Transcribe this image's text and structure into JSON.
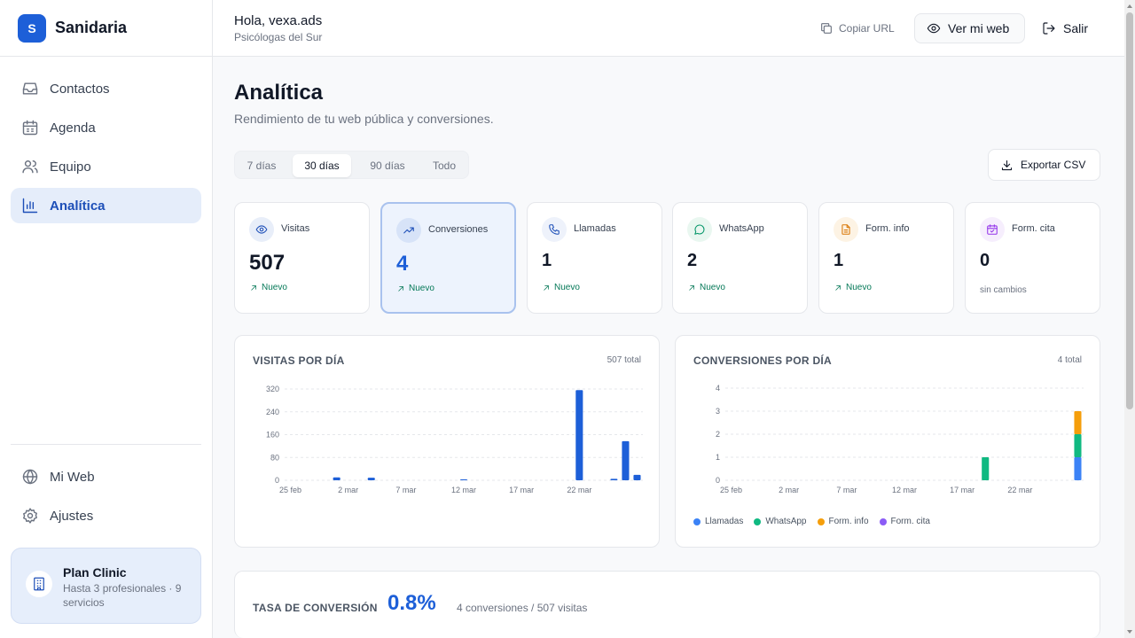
{
  "brand": {
    "initial": "S",
    "name": "Sanidaria",
    "accent": "#1d5fd8"
  },
  "sidebar": {
    "items": [
      {
        "label": "Contactos",
        "icon": "inbox-icon"
      },
      {
        "label": "Agenda",
        "icon": "calendar-icon"
      },
      {
        "label": "Equipo",
        "icon": "users-icon"
      },
      {
        "label": "Analítica",
        "icon": "bar-chart-icon",
        "active": true
      }
    ],
    "bottom_items": [
      {
        "label": "Mi Web",
        "icon": "globe-icon"
      },
      {
        "label": "Ajustes",
        "icon": "gear-icon"
      }
    ],
    "plan": {
      "title": "Plan Clinic",
      "description": "Hasta 3 profesionales · 9 servicios",
      "icon": "building-icon"
    }
  },
  "header": {
    "greeting": "Hola, vexa.ads",
    "organization": "Psicólogas del Sur",
    "copy_url_label": "Copiar URL",
    "view_site_label": "Ver mi web",
    "logout_label": "Salir"
  },
  "page": {
    "title": "Analítica",
    "subtitle": "Rendimiento de tu web pública y conversiones.",
    "range_tabs": [
      "7 días",
      "30 días",
      "90 días",
      "Todo"
    ],
    "selected_range": "30 días",
    "export_label": "Exportar CSV"
  },
  "kpis": [
    {
      "label": "Visitas",
      "value": "507",
      "trend": "Nuevo",
      "icon": "eye-icon",
      "color": "#1d4fb8"
    },
    {
      "label": "Conversiones",
      "value": "4",
      "trend": "Nuevo",
      "icon": "trending-up-icon",
      "color": "#1d4fb8",
      "selected": true
    },
    {
      "label": "Llamadas",
      "value": "1",
      "trend": "Nuevo",
      "icon": "phone-icon",
      "color": "#1d4fb8"
    },
    {
      "label": "WhatsApp",
      "value": "2",
      "trend": "Nuevo",
      "icon": "message-circle-icon",
      "color": "#059669"
    },
    {
      "label": "Form. info",
      "value": "1",
      "trend": "Nuevo",
      "icon": "file-text-icon",
      "color": "#d97706"
    },
    {
      "label": "Form. cita",
      "value": "0",
      "trend": "sin cambios",
      "icon": "calendar-check-icon",
      "color": "#9333ea"
    }
  ],
  "charts": {
    "visits": {
      "title": "VISITAS POR DÍA",
      "total": "507 total"
    },
    "conversions": {
      "title": "CONVERSIONES POR DÍA",
      "total": "4 total"
    }
  },
  "chart_data": [
    {
      "type": "bar",
      "title": "VISITAS POR DÍA",
      "x_tick_labels": [
        "25 feb",
        "2 mar",
        "7 mar",
        "12 mar",
        "17 mar",
        "22 mar"
      ],
      "y_ticks": [
        0,
        80,
        160,
        240,
        320
      ],
      "ylim": [
        0,
        320
      ],
      "x": [
        "25 feb",
        "26 feb",
        "27 feb",
        "28 feb",
        "1 mar",
        "2 mar",
        "3 mar",
        "4 mar",
        "5 mar",
        "6 mar",
        "7 mar",
        "8 mar",
        "9 mar",
        "10 mar",
        "11 mar",
        "12 mar",
        "13 mar",
        "14 mar",
        "15 mar",
        "16 mar",
        "17 mar",
        "18 mar",
        "19 mar",
        "20 mar",
        "21 mar",
        "22 mar",
        "23 mar",
        "24 mar",
        "25 mar",
        "26 mar",
        "27 mar"
      ],
      "series": [
        {
          "values": [
            0,
            0,
            0,
            0,
            10,
            0,
            0,
            9,
            0,
            0,
            0,
            0,
            0,
            0,
            0,
            3,
            0,
            0,
            0,
            0,
            0,
            0,
            0,
            0,
            0,
            316,
            0,
            0,
            5,
            137,
            19
          ],
          "color": "#1d5fd8"
        }
      ],
      "grid": true
    },
    {
      "type": "bar",
      "stacked": true,
      "title": "CONVERSIONES POR DÍA",
      "x_tick_labels": [
        "25 feb",
        "2 mar",
        "7 mar",
        "12 mar",
        "17 mar",
        "22 mar"
      ],
      "y_ticks": [
        0,
        1,
        2,
        3,
        4
      ],
      "ylim": [
        0,
        4
      ],
      "x": [
        "25 feb",
        "26 feb",
        "27 feb",
        "28 feb",
        "1 mar",
        "2 mar",
        "3 mar",
        "4 mar",
        "5 mar",
        "6 mar",
        "7 mar",
        "8 mar",
        "9 mar",
        "10 mar",
        "11 mar",
        "12 mar",
        "13 mar",
        "14 mar",
        "15 mar",
        "16 mar",
        "17 mar",
        "18 mar",
        "19 mar",
        "20 mar",
        "21 mar",
        "22 mar",
        "23 mar",
        "24 mar",
        "25 mar",
        "26 mar",
        "27 mar"
      ],
      "series": [
        {
          "name": "Llamadas",
          "color": "#3b82f6",
          "values": [
            0,
            0,
            0,
            0,
            0,
            0,
            0,
            0,
            0,
            0,
            0,
            0,
            0,
            0,
            0,
            0,
            0,
            0,
            0,
            0,
            0,
            0,
            0,
            0,
            0,
            0,
            0,
            0,
            0,
            0,
            1
          ]
        },
        {
          "name": "WhatsApp",
          "color": "#10b981",
          "values": [
            0,
            0,
            0,
            0,
            0,
            0,
            0,
            0,
            0,
            0,
            0,
            0,
            0,
            0,
            0,
            0,
            0,
            0,
            0,
            0,
            0,
            0,
            1,
            0,
            0,
            0,
            0,
            0,
            0,
            0,
            1
          ]
        },
        {
          "name": "Form. info",
          "color": "#f59e0b",
          "values": [
            0,
            0,
            0,
            0,
            0,
            0,
            0,
            0,
            0,
            0,
            0,
            0,
            0,
            0,
            0,
            0,
            0,
            0,
            0,
            0,
            0,
            0,
            0,
            0,
            0,
            0,
            0,
            0,
            0,
            0,
            1
          ]
        },
        {
          "name": "Form. cita",
          "color": "#8b5cf6",
          "values": [
            0,
            0,
            0,
            0,
            0,
            0,
            0,
            0,
            0,
            0,
            0,
            0,
            0,
            0,
            0,
            0,
            0,
            0,
            0,
            0,
            0,
            0,
            0,
            0,
            0,
            0,
            0,
            0,
            0,
            0,
            0
          ]
        }
      ],
      "legend_position": "bottom-left",
      "grid": true
    }
  ],
  "conversion_rate": {
    "title": "TASA DE CONVERSIÓN",
    "value": "0.8%",
    "detail": "4 conversiones / 507 visitas"
  }
}
